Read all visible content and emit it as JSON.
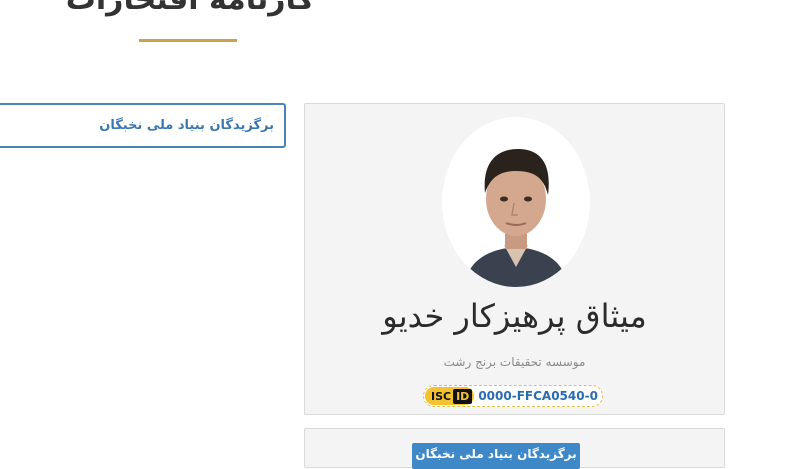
{
  "page": {
    "title": "کارنامه افتخارات"
  },
  "award_tag": {
    "label": "برگزیدگان بنیاد ملی نخبگان"
  },
  "profile": {
    "name": "میثاق پرهیزکار خدیو",
    "institution": "موسسه تحقیقات برنج رشت",
    "isc_logo_text": "ISC",
    "isc_id_text": "ID",
    "isc_code": "0000-FFCA0540-0"
  },
  "bottom_card": {
    "button_label": "برگزیدگان بنیاد ملی نخبگان"
  },
  "colors": {
    "accent_gold": "#c9a44c",
    "link_blue": "#3a77b0",
    "card_background": "#f4f4f4",
    "isc_yellow": "#f2c230"
  },
  "icons": {
    "avatar": "person-photo",
    "isc_logo": "isc-id-logo"
  }
}
